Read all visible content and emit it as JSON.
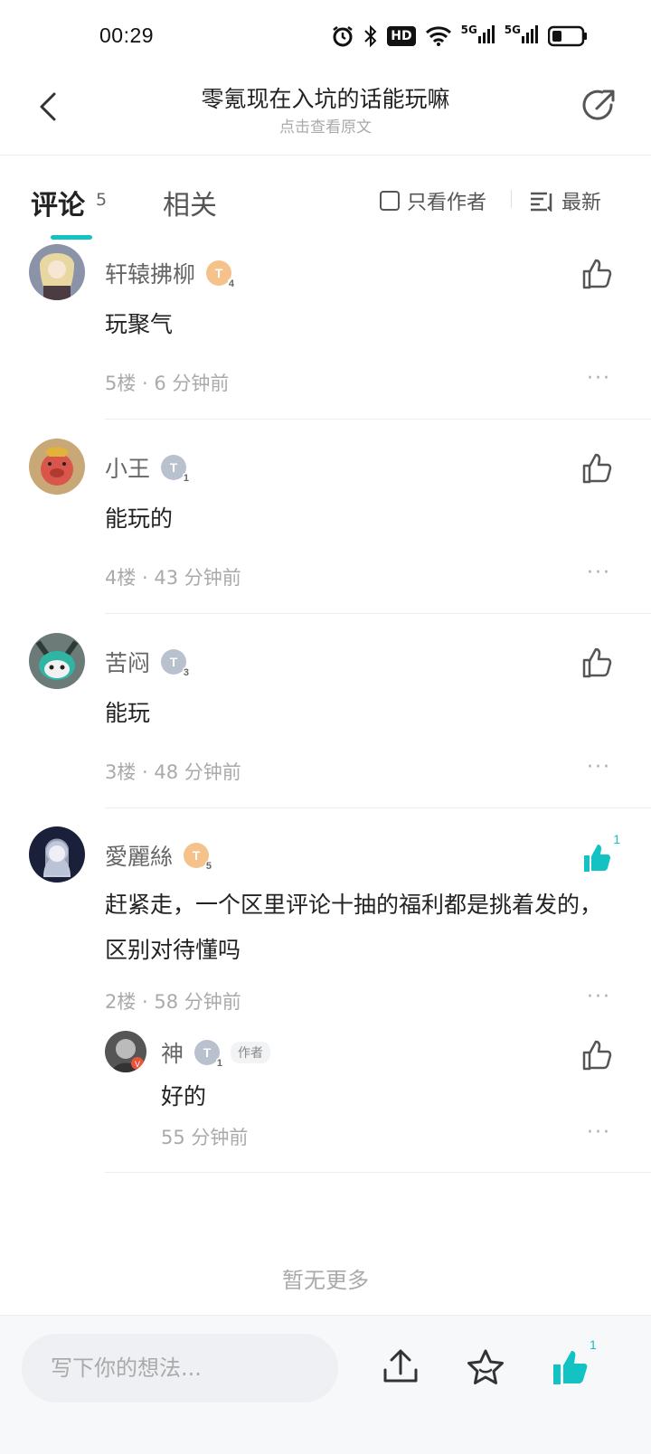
{
  "status": {
    "time": "00:29",
    "hd": "HD",
    "net1": "5G",
    "net2": "5G"
  },
  "header": {
    "title": "零氪现在入坑的话能玩嘛",
    "subtitle": "点击查看原文"
  },
  "tabs": {
    "comment": "评论",
    "comment_count": "5",
    "related": "相关",
    "only_author": "只看作者",
    "sort": "最新"
  },
  "comments": [
    {
      "user": "轩辕拂柳",
      "level": "4",
      "level_color": "gold",
      "text": "玩聚气",
      "floor": "5楼 · 6 分钟前",
      "likes": ""
    },
    {
      "user": "小王",
      "level": "1",
      "level_color": "silver",
      "text": "能玩的",
      "floor": "4楼 · 43 分钟前",
      "likes": ""
    },
    {
      "user": "苦闷",
      "level": "3",
      "level_color": "silver",
      "text": "能玩",
      "floor": "3楼 · 48 分钟前",
      "likes": ""
    },
    {
      "user": "愛麗絲",
      "level": "5",
      "level_color": "gold",
      "text": "赶紧走，一个区里评论十抽的福利都是挑着发的，区别对待懂吗",
      "floor": "2楼 · 58 分钟前",
      "likes": "1"
    }
  ],
  "reply": {
    "user": "神",
    "level": "1",
    "author_tag": "作者",
    "text": "好的",
    "time": "55 分钟前"
  },
  "level_letter": "T",
  "more_dots": "···",
  "footer": {
    "no_more": "暂无更多",
    "input_placeholder": "写下你的想法...",
    "like_count": "1"
  },
  "colors": {
    "accent": "#13c2c2",
    "gold_badge": "#f4c28a",
    "silver_badge": "#b9c1cf"
  }
}
